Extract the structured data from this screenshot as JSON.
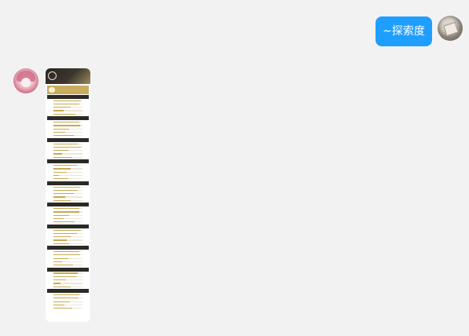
{
  "chat": {
    "user_message": "~探索度",
    "user_avatar_icon": "user-avatar-icon",
    "bot_avatar_icon": "bot-avatar-icon",
    "colors": {
      "bubble": "#1e9fff",
      "background": "#f2f2f2",
      "accent_gold": "#c9ad5e",
      "region_header": "#2b2a26"
    }
  },
  "card": {
    "header": {
      "name": "",
      "subtitle": ""
    },
    "summary": {
      "label": "",
      "meta": ""
    },
    "regions": [
      {
        "name": "",
        "rows": [
          {
            "label": "",
            "value": 0.95,
            "pct": ""
          },
          {
            "label": "",
            "value": 0.88,
            "pct": ""
          },
          {
            "label": "",
            "value": 0.6,
            "pct": ""
          },
          {
            "label": "",
            "value": 0.35,
            "pct": ""
          },
          {
            "label": "",
            "value": 0.75,
            "pct": ""
          }
        ]
      },
      {
        "name": "",
        "rows": [
          {
            "label": "",
            "value": 0.9,
            "pct": ""
          },
          {
            "label": "",
            "value": 0.92,
            "pct": ""
          },
          {
            "label": "",
            "value": 0.55,
            "pct": ""
          },
          {
            "label": "",
            "value": 0.4,
            "pct": ""
          },
          {
            "label": "",
            "value": 0.7,
            "pct": ""
          }
        ]
      },
      {
        "name": "",
        "rows": [
          {
            "label": "",
            "value": 0.85,
            "pct": ""
          },
          {
            "label": "",
            "value": 0.95,
            "pct": ""
          },
          {
            "label": "",
            "value": 0.5,
            "pct": ""
          },
          {
            "label": "",
            "value": 0.3,
            "pct": ""
          },
          {
            "label": "",
            "value": 0.65,
            "pct": ""
          }
        ]
      },
      {
        "name": "",
        "rows": [
          {
            "label": "",
            "value": 0.8,
            "pct": ""
          },
          {
            "label": "",
            "value": 0.6,
            "pct": ""
          },
          {
            "label": "",
            "value": 0.45,
            "pct": ""
          },
          {
            "label": "",
            "value": 0.2,
            "pct": ""
          },
          {
            "label": "",
            "value": 0.5,
            "pct": ""
          }
        ]
      },
      {
        "name": "",
        "rows": [
          {
            "label": "",
            "value": 0.92,
            "pct": ""
          },
          {
            "label": "",
            "value": 0.85,
            "pct": ""
          },
          {
            "label": "",
            "value": 0.7,
            "pct": ""
          },
          {
            "label": "",
            "value": 0.4,
            "pct": ""
          },
          {
            "label": "",
            "value": 0.6,
            "pct": ""
          }
        ]
      },
      {
        "name": "",
        "rows": [
          {
            "label": "",
            "value": 0.88,
            "pct": ""
          },
          {
            "label": "",
            "value": 0.9,
            "pct": ""
          },
          {
            "label": "",
            "value": 0.55,
            "pct": ""
          },
          {
            "label": "",
            "value": 0.35,
            "pct": ""
          },
          {
            "label": "",
            "value": 0.72,
            "pct": ""
          }
        ]
      },
      {
        "name": "",
        "rows": [
          {
            "label": "",
            "value": 0.95,
            "pct": ""
          },
          {
            "label": "",
            "value": 0.8,
            "pct": ""
          },
          {
            "label": "",
            "value": 0.6,
            "pct": ""
          },
          {
            "label": "",
            "value": 0.45,
            "pct": ""
          },
          {
            "label": "",
            "value": 0.55,
            "pct": ""
          }
        ]
      },
      {
        "name": "",
        "rows": [
          {
            "label": "",
            "value": 0.9,
            "pct": ""
          },
          {
            "label": "",
            "value": 0.93,
            "pct": ""
          },
          {
            "label": "",
            "value": 0.5,
            "pct": ""
          },
          {
            "label": "",
            "value": 0.3,
            "pct": ""
          },
          {
            "label": "",
            "value": 0.68,
            "pct": ""
          }
        ]
      },
      {
        "name": "",
        "rows": [
          {
            "label": "",
            "value": 0.85,
            "pct": ""
          },
          {
            "label": "",
            "value": 0.78,
            "pct": ""
          },
          {
            "label": "",
            "value": 0.42,
            "pct": ""
          },
          {
            "label": "",
            "value": 0.25,
            "pct": ""
          },
          {
            "label": "",
            "value": 0.6,
            "pct": ""
          }
        ]
      },
      {
        "name": "",
        "rows": [
          {
            "label": "",
            "value": 0.9,
            "pct": ""
          },
          {
            "label": "",
            "value": 0.86,
            "pct": ""
          },
          {
            "label": "",
            "value": 0.58,
            "pct": ""
          },
          {
            "label": "",
            "value": 0.38,
            "pct": ""
          },
          {
            "label": "",
            "value": 0.64,
            "pct": ""
          }
        ]
      }
    ]
  }
}
